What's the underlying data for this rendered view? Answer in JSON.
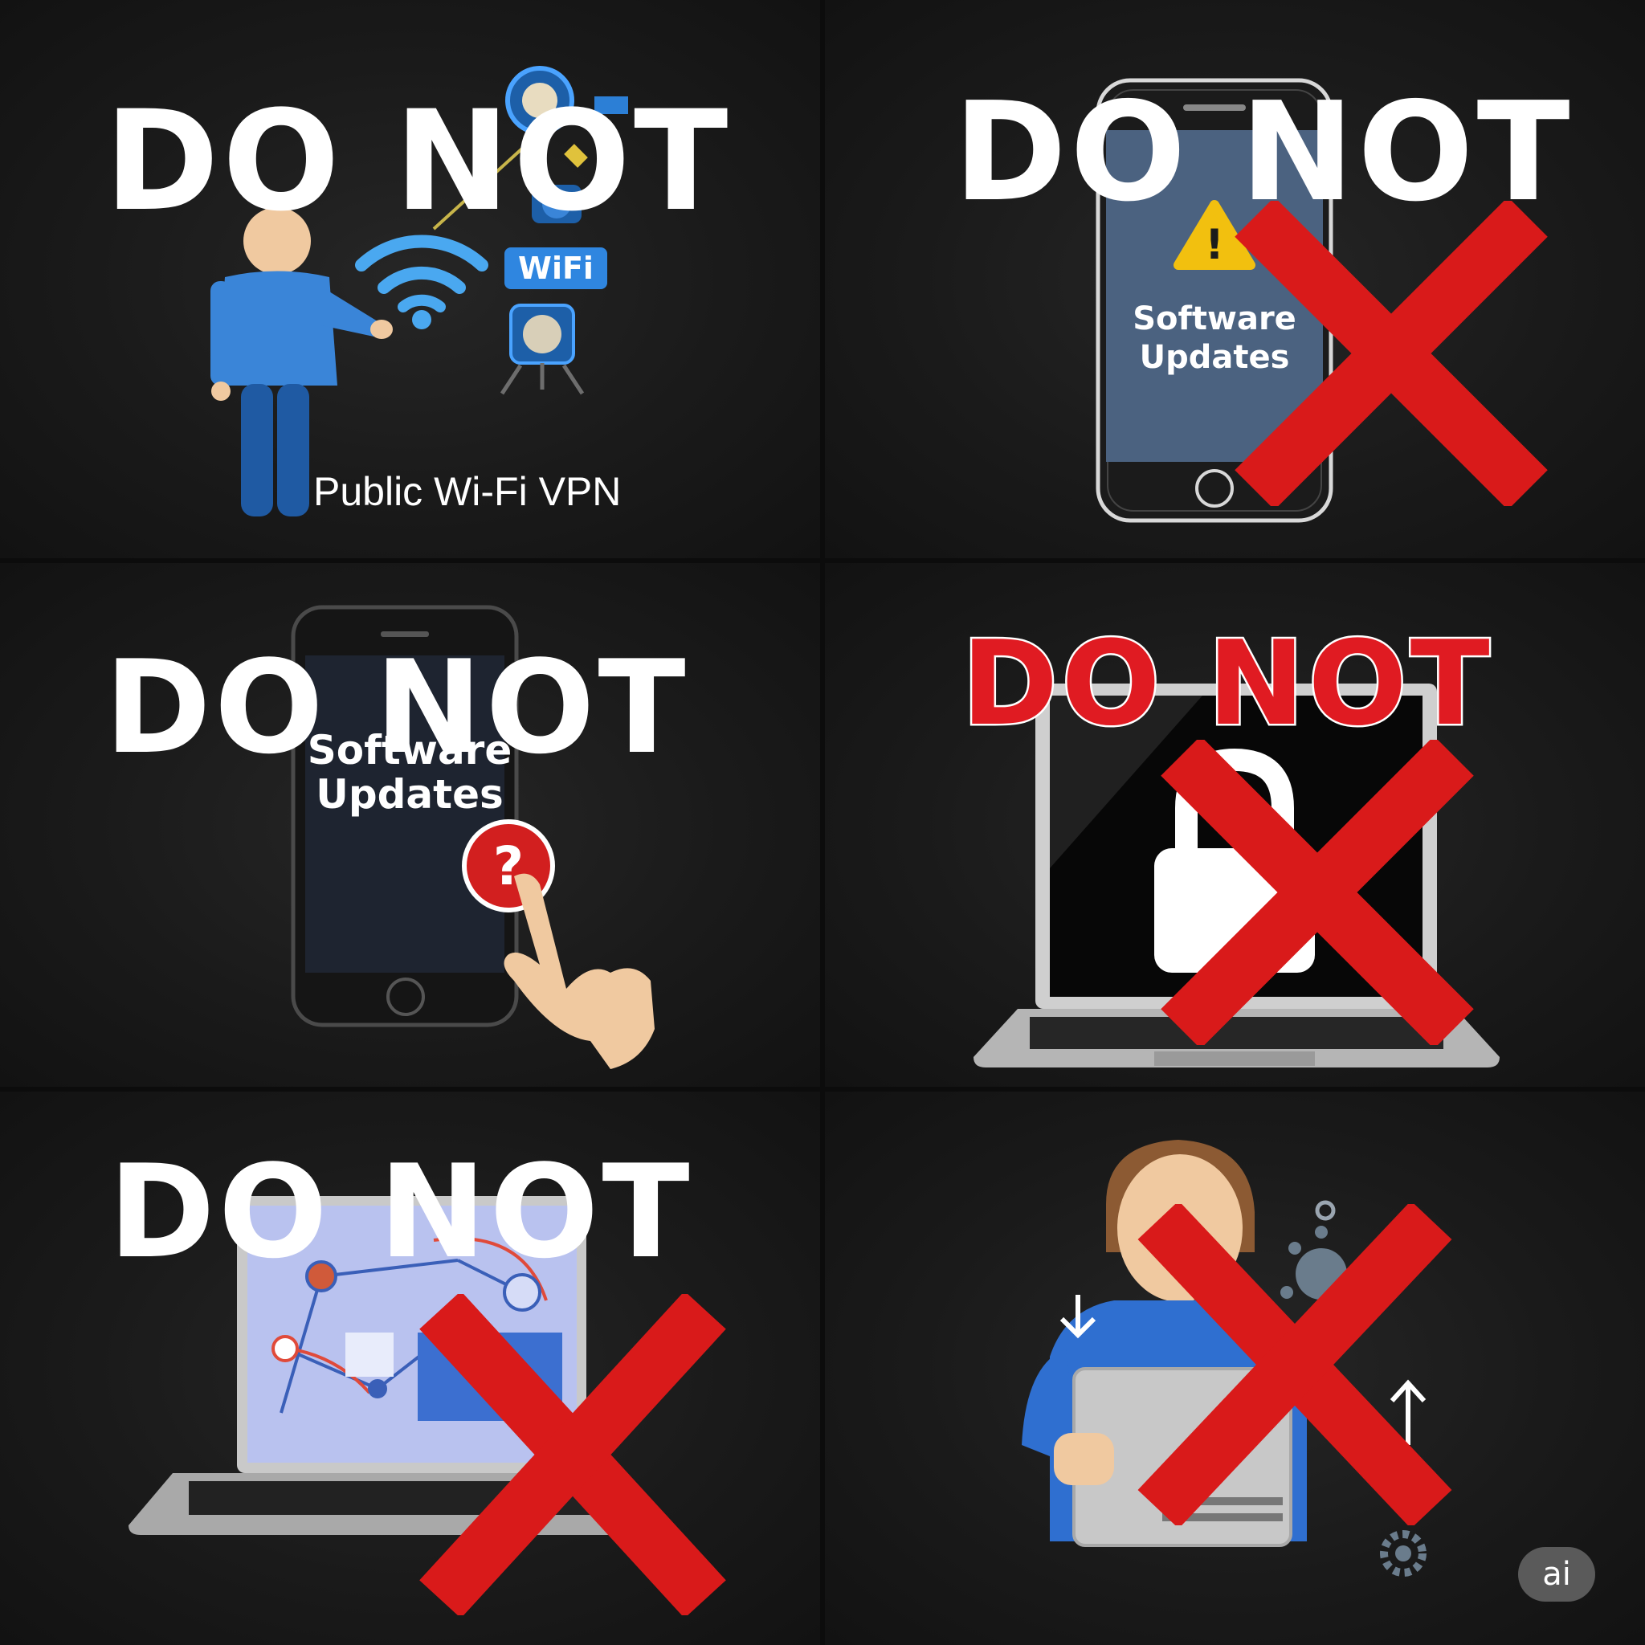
{
  "panels": [
    {
      "id": "panel-1",
      "heading": "DO NOT",
      "labels": {
        "wifi_badge": "WiFi",
        "caption": "Public Wi-Fi VPN"
      }
    },
    {
      "id": "panel-2",
      "heading": "DO NOT",
      "labels": {
        "screen_line1": "Software",
        "screen_line2": "Updates",
        "warning": "!"
      }
    },
    {
      "id": "panel-3",
      "heading": "DO NOT",
      "labels": {
        "screen_line1": "Software",
        "screen_line2": "Updates",
        "question": "?"
      }
    },
    {
      "id": "panel-4",
      "heading": "DO NOT"
    },
    {
      "id": "panel-5",
      "heading": "DO NOT"
    },
    {
      "id": "panel-6",
      "badge": "ai"
    }
  ],
  "colors": {
    "background": "#1a1a1a",
    "heading_white": "#ffffff",
    "heading_red": "#e01b22",
    "cross_red": "#d91a1a",
    "accent_blue": "#3a85d8",
    "skin": "#f0c9a0"
  },
  "icons": [
    "person-icon",
    "wifi-icon",
    "satellite-icon",
    "smartphone-icon",
    "warning-icon",
    "pointing-hand-icon",
    "question-icon",
    "laptop-icon",
    "padlock-icon",
    "network-map-icon",
    "virus-icon",
    "gear-icon",
    "arrow-down-icon",
    "arrow-up-icon",
    "cross-icon"
  ]
}
